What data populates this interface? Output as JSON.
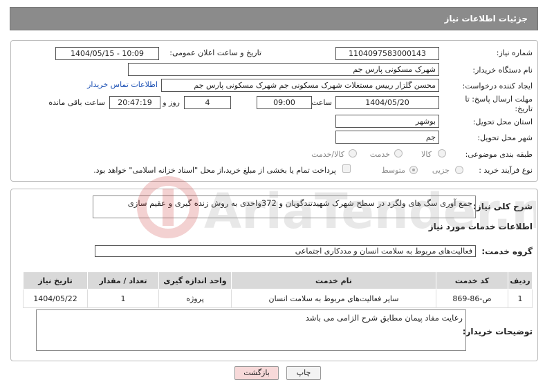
{
  "header": {
    "title": "جزئیات اطلاعات نیاز"
  },
  "fields": {
    "need_number_label": "شماره نیاز:",
    "need_number": "1104097583000143",
    "announce_label": "تاریخ و ساعت اعلان عمومی:",
    "announce_value": "1404/05/15 - 10:09",
    "buyer_org_label": "نام دستگاه خریدار:",
    "buyer_org": "شهرک مسکونی پارس جم",
    "creator_label": "ایجاد کننده درخواست:",
    "creator": "محسن گلزار رییس مستغلات شهرک مسکونی جم شهرک مسکونی پارس جم",
    "contact_link": "اطلاعات تماس خریدار",
    "deadline_label": "مهلت ارسال پاسخ: تا تاریخ:",
    "deadline_date": "1404/05/20",
    "time_label": "ساعت",
    "deadline_time": "09:00",
    "days_value": "4",
    "days_label": "روز و",
    "remaining_time": "20:47:19",
    "remaining_label": "ساعت باقی مانده",
    "province_label": "استان محل تحویل:",
    "province": "بوشهر",
    "city_label": "شهر محل تحویل:",
    "city": "جم",
    "category_label": "طبقه بندی موضوعی:",
    "category_options": [
      "کالا",
      "خدمت",
      "کالا/خدمت"
    ],
    "process_label": "نوع فرآیند خرید :",
    "process_options": [
      "جزیی",
      "متوسط"
    ],
    "payment_note": "پرداخت تمام یا بخشی از مبلغ خرید،از محل \"اسناد خزانه اسلامی\" خواهد بود."
  },
  "summary": {
    "label": "شرح کلی نیاز:",
    "text": "جمع آوری سگ های ولگرد در سطح شهرک شهیدتندگویان و 372واحدی به روش زنده گیری و عقیم سازی"
  },
  "services": {
    "section_title": "اطلاعات خدمات مورد نیاز",
    "group_label": "گروه خدمت:",
    "group_value": "فعالیت‌های مربوط به سلامت انسان و مددکاری اجتماعی",
    "columns": [
      "ردیف",
      "کد خدمت",
      "نام خدمت",
      "واحد اندازه گیری",
      "تعداد / مقدار",
      "تاریخ نیاز"
    ],
    "rows": [
      [
        "1",
        "ص-86-869",
        "سایر فعالیت‌های مربوط به سلامت انسان",
        "پروژه",
        "1",
        "1404/05/22"
      ]
    ]
  },
  "buyer_notes": {
    "label": "توضیحات خریدار:",
    "text": "رعایت مفاد پیمان مطابق شرح الزامی می باشد"
  },
  "buttons": {
    "print": "چاپ",
    "back": "بازگشت"
  },
  "watermark": {
    "text": "AriaTender.neT"
  },
  "colors": {
    "header_bg": "#8b8b8b",
    "link": "#1a4fb4",
    "table_header": "#d9d9d9",
    "back_button": "#f7d9d9"
  }
}
